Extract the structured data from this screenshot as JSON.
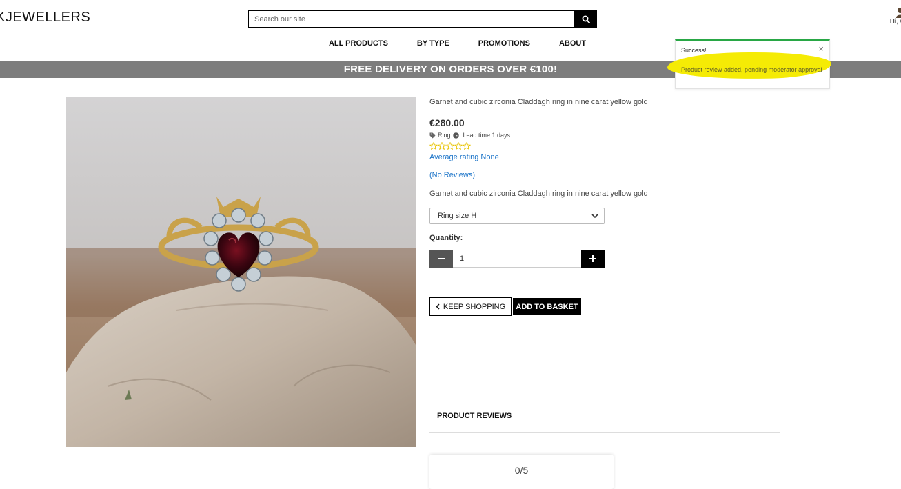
{
  "header": {
    "brand": "KJEWELLERS",
    "search_placeholder": "Search our site",
    "account_greeting": "Hi, C"
  },
  "nav": {
    "items": [
      "ALL PRODUCTS",
      "BY TYPE",
      "PROMOTIONS",
      "ABOUT"
    ]
  },
  "banner": {
    "text": "FREE DELIVERY ON ORDERS OVER €100!"
  },
  "toast": {
    "title": "Success!",
    "message": "Product review added, pending moderator approval",
    "close": "×",
    "highlight_color": "#f5eb05",
    "border_color": "#28a745"
  },
  "product": {
    "title": "Garnet and cubic zirconia Claddagh ring in nine carat yellow gold",
    "price": "€280.00",
    "category": "Ring",
    "lead_time": "Lead time 1 days",
    "average_rating": "Average rating None",
    "reviews_link": "(No Reviews)",
    "description": "Garnet and cubic zirconia Claddagh ring in nine carat yellow gold",
    "size_selected": "Ring size H",
    "quantity_label": "Quantity:",
    "quantity_value": "1",
    "stars_empty": 5
  },
  "actions": {
    "keep_shopping": "KEEP SHOPPING",
    "add_to_basket": "ADD TO BASKET"
  },
  "reviews": {
    "heading": "PRODUCT REVIEWS",
    "score": "0/5"
  },
  "colors": {
    "link": "#1a73c8",
    "star": "#e8c300",
    "banner": "#7d7d7d"
  }
}
